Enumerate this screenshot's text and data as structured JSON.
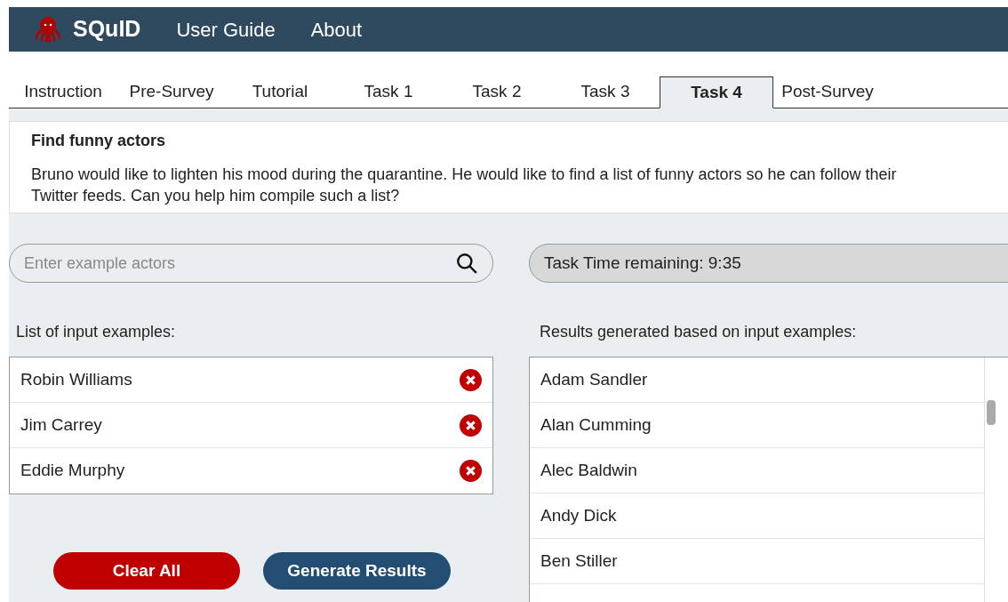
{
  "navbar": {
    "brand": "SQuID",
    "links": [
      "User Guide",
      "About"
    ]
  },
  "tabs": [
    {
      "label": "Instruction",
      "selected": false
    },
    {
      "label": "Pre-Survey",
      "selected": false
    },
    {
      "label": "Tutorial",
      "selected": false
    },
    {
      "label": "Task 1",
      "selected": false
    },
    {
      "label": "Task 2",
      "selected": false
    },
    {
      "label": "Task 3",
      "selected": false
    },
    {
      "label": "Task 4",
      "selected": true
    },
    {
      "label": "Post-Survey",
      "selected": false
    }
  ],
  "task": {
    "title": "Find funny actors",
    "description": "Bruno would like to lighten his mood during the quarantine.  He would like to find a list of funny actors so he can follow their Twitter feeds. Can you help him compile such a list?"
  },
  "search": {
    "placeholder": "Enter example actors"
  },
  "timer": "Task Time remaining: 9:35",
  "examples": {
    "label": "List of input examples:",
    "items": [
      "Robin Williams",
      "Jim Carrey",
      "Eddie Murphy"
    ]
  },
  "results": {
    "label": "Results generated based on input examples:",
    "items": [
      "Adam Sandler",
      "Alan Cumming",
      "Alec Baldwin",
      "Andy Dick",
      "Ben Stiller"
    ]
  },
  "buttons": [
    "Clear All",
    "Generate Results"
  ]
}
